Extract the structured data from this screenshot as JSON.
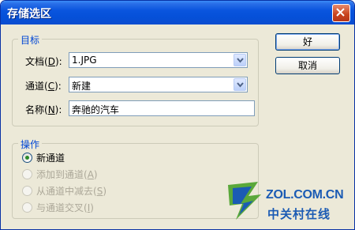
{
  "dialog": {
    "title": "存储选区",
    "close_icon": "close-icon"
  },
  "target_group": {
    "legend": "目标",
    "document": {
      "label": "文档(",
      "mnemonic": "D",
      "label_end": "):",
      "value": "1.JPG"
    },
    "channel": {
      "label": "通道(",
      "mnemonic": "C",
      "label_end": "):",
      "value": "新建"
    },
    "name": {
      "label": "名称(",
      "mnemonic": "N",
      "label_end": "):",
      "value": "奔驰的汽车"
    }
  },
  "buttons": {
    "ok": "好",
    "cancel": "取消"
  },
  "operation_group": {
    "legend": "操作",
    "options": [
      {
        "text": "新通道",
        "mnemonic": "",
        "end": "",
        "selected": true,
        "disabled": false
      },
      {
        "text": "添加到通道(",
        "mnemonic": "A",
        "end": ")",
        "selected": false,
        "disabled": true
      },
      {
        "text": "从通道中减去(",
        "mnemonic": "S",
        "end": ")",
        "selected": false,
        "disabled": true
      },
      {
        "text": "与通道交叉(",
        "mnemonic": "I",
        "end": ")",
        "selected": false,
        "disabled": true
      }
    ]
  },
  "watermark": {
    "domain": "ZOL.COM.CN",
    "chinese": "中关村在线",
    "colors": {
      "blue": "#1b5bb4",
      "green": "#5aa83a"
    }
  },
  "colors": {
    "title_bar": "#0a55de",
    "dialog_bg": "#ece9d8",
    "legend_text": "#0046d5",
    "disabled_text": "#aca899"
  }
}
